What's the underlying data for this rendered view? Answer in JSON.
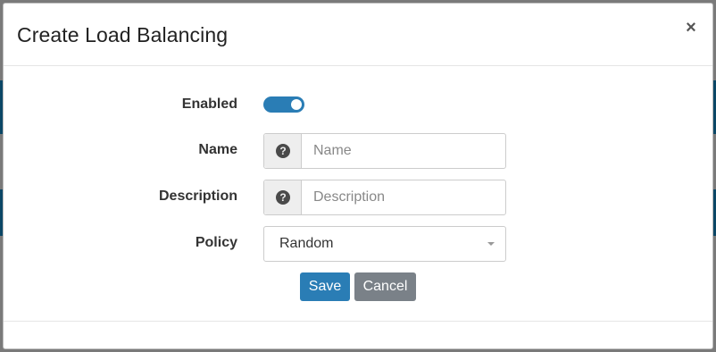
{
  "dialog": {
    "title": "Create Load Balancing",
    "close_label": "×"
  },
  "form": {
    "enabled": {
      "label": "Enabled",
      "value": true
    },
    "name": {
      "label": "Name",
      "placeholder": "Name",
      "value": ""
    },
    "description": {
      "label": "Description",
      "placeholder": "Description",
      "value": ""
    },
    "policy": {
      "label": "Policy",
      "selected": "Random"
    },
    "help_icon_glyph": "?"
  },
  "buttons": {
    "save": "Save",
    "cancel": "Cancel"
  },
  "colors": {
    "accent": "#2a7db5",
    "secondary_button": "#7a8188",
    "overlay_band": "#0b4766"
  },
  "icons": [
    "close-icon",
    "help-icon",
    "caret-down-icon"
  ]
}
